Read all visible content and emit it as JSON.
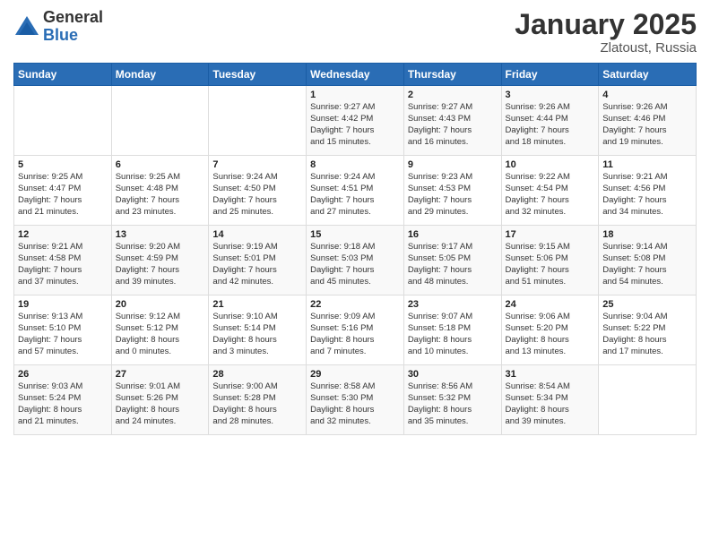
{
  "logo": {
    "general": "General",
    "blue": "Blue"
  },
  "title": "January 2025",
  "location": "Zlatoust, Russia",
  "days_of_week": [
    "Sunday",
    "Monday",
    "Tuesday",
    "Wednesday",
    "Thursday",
    "Friday",
    "Saturday"
  ],
  "weeks": [
    [
      {
        "day": "",
        "content": ""
      },
      {
        "day": "",
        "content": ""
      },
      {
        "day": "",
        "content": ""
      },
      {
        "day": "1",
        "content": "Sunrise: 9:27 AM\nSunset: 4:42 PM\nDaylight: 7 hours\nand 15 minutes."
      },
      {
        "day": "2",
        "content": "Sunrise: 9:27 AM\nSunset: 4:43 PM\nDaylight: 7 hours\nand 16 minutes."
      },
      {
        "day": "3",
        "content": "Sunrise: 9:26 AM\nSunset: 4:44 PM\nDaylight: 7 hours\nand 18 minutes."
      },
      {
        "day": "4",
        "content": "Sunrise: 9:26 AM\nSunset: 4:46 PM\nDaylight: 7 hours\nand 19 minutes."
      }
    ],
    [
      {
        "day": "5",
        "content": "Sunrise: 9:25 AM\nSunset: 4:47 PM\nDaylight: 7 hours\nand 21 minutes."
      },
      {
        "day": "6",
        "content": "Sunrise: 9:25 AM\nSunset: 4:48 PM\nDaylight: 7 hours\nand 23 minutes."
      },
      {
        "day": "7",
        "content": "Sunrise: 9:24 AM\nSunset: 4:50 PM\nDaylight: 7 hours\nand 25 minutes."
      },
      {
        "day": "8",
        "content": "Sunrise: 9:24 AM\nSunset: 4:51 PM\nDaylight: 7 hours\nand 27 minutes."
      },
      {
        "day": "9",
        "content": "Sunrise: 9:23 AM\nSunset: 4:53 PM\nDaylight: 7 hours\nand 29 minutes."
      },
      {
        "day": "10",
        "content": "Sunrise: 9:22 AM\nSunset: 4:54 PM\nDaylight: 7 hours\nand 32 minutes."
      },
      {
        "day": "11",
        "content": "Sunrise: 9:21 AM\nSunset: 4:56 PM\nDaylight: 7 hours\nand 34 minutes."
      }
    ],
    [
      {
        "day": "12",
        "content": "Sunrise: 9:21 AM\nSunset: 4:58 PM\nDaylight: 7 hours\nand 37 minutes."
      },
      {
        "day": "13",
        "content": "Sunrise: 9:20 AM\nSunset: 4:59 PM\nDaylight: 7 hours\nand 39 minutes."
      },
      {
        "day": "14",
        "content": "Sunrise: 9:19 AM\nSunset: 5:01 PM\nDaylight: 7 hours\nand 42 minutes."
      },
      {
        "day": "15",
        "content": "Sunrise: 9:18 AM\nSunset: 5:03 PM\nDaylight: 7 hours\nand 45 minutes."
      },
      {
        "day": "16",
        "content": "Sunrise: 9:17 AM\nSunset: 5:05 PM\nDaylight: 7 hours\nand 48 minutes."
      },
      {
        "day": "17",
        "content": "Sunrise: 9:15 AM\nSunset: 5:06 PM\nDaylight: 7 hours\nand 51 minutes."
      },
      {
        "day": "18",
        "content": "Sunrise: 9:14 AM\nSunset: 5:08 PM\nDaylight: 7 hours\nand 54 minutes."
      }
    ],
    [
      {
        "day": "19",
        "content": "Sunrise: 9:13 AM\nSunset: 5:10 PM\nDaylight: 7 hours\nand 57 minutes."
      },
      {
        "day": "20",
        "content": "Sunrise: 9:12 AM\nSunset: 5:12 PM\nDaylight: 8 hours\nand 0 minutes."
      },
      {
        "day": "21",
        "content": "Sunrise: 9:10 AM\nSunset: 5:14 PM\nDaylight: 8 hours\nand 3 minutes."
      },
      {
        "day": "22",
        "content": "Sunrise: 9:09 AM\nSunset: 5:16 PM\nDaylight: 8 hours\nand 7 minutes."
      },
      {
        "day": "23",
        "content": "Sunrise: 9:07 AM\nSunset: 5:18 PM\nDaylight: 8 hours\nand 10 minutes."
      },
      {
        "day": "24",
        "content": "Sunrise: 9:06 AM\nSunset: 5:20 PM\nDaylight: 8 hours\nand 13 minutes."
      },
      {
        "day": "25",
        "content": "Sunrise: 9:04 AM\nSunset: 5:22 PM\nDaylight: 8 hours\nand 17 minutes."
      }
    ],
    [
      {
        "day": "26",
        "content": "Sunrise: 9:03 AM\nSunset: 5:24 PM\nDaylight: 8 hours\nand 21 minutes."
      },
      {
        "day": "27",
        "content": "Sunrise: 9:01 AM\nSunset: 5:26 PM\nDaylight: 8 hours\nand 24 minutes."
      },
      {
        "day": "28",
        "content": "Sunrise: 9:00 AM\nSunset: 5:28 PM\nDaylight: 8 hours\nand 28 minutes."
      },
      {
        "day": "29",
        "content": "Sunrise: 8:58 AM\nSunset: 5:30 PM\nDaylight: 8 hours\nand 32 minutes."
      },
      {
        "day": "30",
        "content": "Sunrise: 8:56 AM\nSunset: 5:32 PM\nDaylight: 8 hours\nand 35 minutes."
      },
      {
        "day": "31",
        "content": "Sunrise: 8:54 AM\nSunset: 5:34 PM\nDaylight: 8 hours\nand 39 minutes."
      },
      {
        "day": "",
        "content": ""
      }
    ]
  ]
}
